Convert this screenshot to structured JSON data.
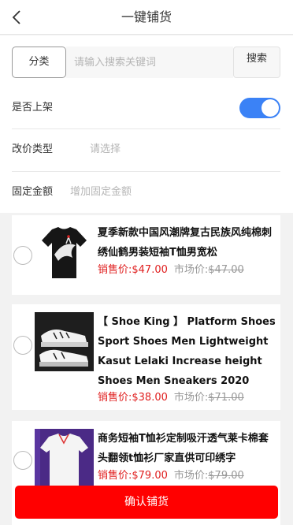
{
  "header": {
    "title": "一键铺货"
  },
  "search": {
    "category_label": "分类",
    "placeholder": "请输入搜索关键词",
    "button_label": "搜索"
  },
  "form": {
    "listed": {
      "label": "是否上架",
      "enabled": true
    },
    "price_type": {
      "label": "改价类型",
      "placeholder": "请选择"
    },
    "fixed_amount": {
      "label": "固定金额",
      "placeholder": "增加固定金额"
    }
  },
  "products": [
    {
      "title": "夏季新款中国风潮牌复古民族风纯棉刺绣仙鹤男装短袖T恤男宽松",
      "sale_label": "销售价:",
      "sale_price": "$47.00",
      "market_label": "市场价:",
      "market_price": "$47.00",
      "image_icon": "black-tshirt-crane-image"
    },
    {
      "title": "【 Shoe King 】 Platform Shoes Sport Shoes Men Lightweight Kasut Lelaki Increase height Shoes Men Sneakers 2020 New",
      "sale_label": "销售价:",
      "sale_price": "$38.00",
      "market_label": "市场价:",
      "market_price": "$71.00",
      "image_icon": "sneakers-image"
    },
    {
      "title": "商务短袖T恤衫定制吸汗透气莱卡棉套头翻领t恤衫厂家直供可印绣字",
      "sale_label": "销售价:",
      "sale_price": "$79.00",
      "market_label": "市场价:",
      "market_price": "$79.00",
      "image_icon": "polo-shirt-image"
    }
  ],
  "footer": {
    "confirm_label": "确认铺货"
  },
  "colors": {
    "accent": "#3b82f6",
    "confirm": "#ff0000",
    "sale_price": "#e02020"
  }
}
